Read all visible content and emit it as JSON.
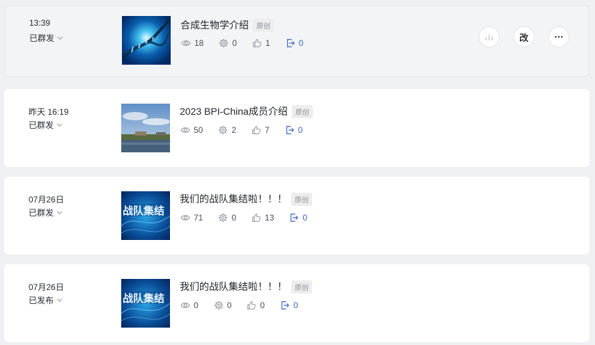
{
  "articles": [
    {
      "date": "13:39",
      "status": "已群发",
      "title": "合成生物学介绍",
      "tag": "原创",
      "views": "18",
      "looks": "0",
      "likes": "1",
      "shares": "0",
      "thumb": "dna-image"
    },
    {
      "date": "昨天 16:19",
      "status": "已群发",
      "title": "2023 BPI-China成员介绍",
      "tag": "原创",
      "views": "50",
      "looks": "2",
      "likes": "7",
      "shares": "0",
      "thumb": "landscape-image"
    },
    {
      "date": "07月26日",
      "status": "已群发",
      "title": "我们的战队集结啦！！！",
      "tag": "原创",
      "views": "71",
      "looks": "0",
      "likes": "13",
      "shares": "0",
      "thumb": "team-poster-image"
    },
    {
      "date": "07月26日",
      "status": "已发布",
      "title": "我们的战队集结啦！！！",
      "tag": "原创",
      "views": "0",
      "looks": "0",
      "likes": "0",
      "shares": "0",
      "thumb": "team-poster-image"
    }
  ],
  "actions": {
    "stats_icon": "bar-chart-icon",
    "edit_label": "改",
    "more_icon": "more-icon"
  },
  "colors": {
    "share": "#3a66c4",
    "background": "#eef0f3"
  }
}
